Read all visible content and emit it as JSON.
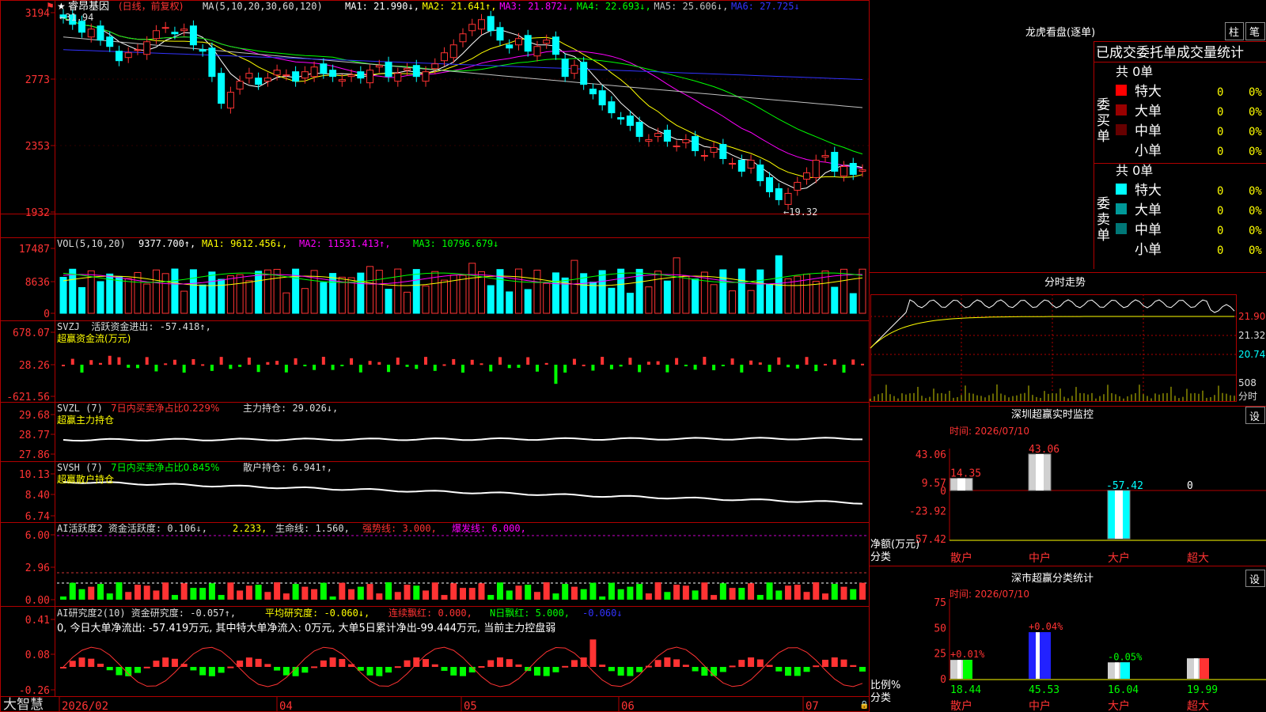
{
  "stock": {
    "marker": "★",
    "name": "睿昂基因",
    "period": "(日线，前复权)"
  },
  "price_panel": {
    "ma_title": "MA(5,10,20,30,60,120)",
    "ma_values": [
      {
        "label": "MA1:",
        "value": "21.990↓,",
        "color": "#ffffff"
      },
      {
        "label": "MA2:",
        "value": "21.641↑,",
        "color": "#ffff00"
      },
      {
        "label": "MA3:",
        "value": "21.872↓,",
        "color": "#ff00ff"
      },
      {
        "label": "MA4:",
        "value": "22.693↓,",
        "color": "#00ff00"
      },
      {
        "label": "MA5:",
        "value": "25.606↓,",
        "color": "#c0c0c0"
      },
      {
        "label": "MA6:",
        "value": "27.725↓",
        "color": "#3333ff"
      }
    ],
    "y_ticks": [
      "3194",
      "2773",
      "2353",
      "1932"
    ],
    "high_label": "←31.94",
    "low_label": "←19.32"
  },
  "vol_panel": {
    "title": "VOL(5,10,20)",
    "value": "9377.700↑,",
    "ma1": "MA1: 9612.456↓,",
    "ma2": "MA2: 11531.413↑,",
    "ma3": "MA3: 10796.679↓",
    "y_ticks": [
      "17487",
      "8636",
      "0"
    ]
  },
  "svzj_panel": {
    "title": "SVZJ  活跃资金进出: -57.418↑,",
    "subtitle": "超赢资金流(万元)",
    "y_ticks": [
      "678.07",
      "28.26",
      "-621.56"
    ]
  },
  "svzl_panel": {
    "title": "SVZL (7)",
    "t2": "7日内买卖净占比0.229%",
    "t3": "主力持仓: 29.026↓,",
    "subtitle": "超赢主力持仓",
    "y_ticks": [
      "29.68",
      "28.77",
      "27.86"
    ]
  },
  "svsh_panel": {
    "title": "SVSH (7)",
    "t2": "7日内买卖净占比0.845%",
    "t3": "散户持仓: 6.941↑,",
    "subtitle": "超赢散户持仓",
    "y_ticks": [
      "10.13",
      "8.40",
      "6.74"
    ]
  },
  "ai_act_panel": {
    "t1": "AI活跃度2 资金活跃度: 0.106↓,",
    "t2": "2.233,",
    "t3": "生命线: 1.560,",
    "t4": "强势线: 3.000,",
    "t5": "爆发线: 6.000,",
    "y_ticks": [
      "6.00",
      "2.96",
      "0.00"
    ]
  },
  "ai_res_panel": {
    "t1": "AI研究度2(10) 资金研究度: -0.057↑,",
    "t2": "平均研究度: -0.060↓,",
    "t3": "连续飘红: 0.000,",
    "t4": "N日飘红: 5.000,",
    "t5": "-0.060↓",
    "line2": "0, 今日大单净流出: -57.419万元, 其中特大单净流入: 0万元, 大单5日累计净出-99.444万元, 当前主力控盘弱",
    "y_ticks": [
      "0.41",
      "0.08",
      "-0.26"
    ]
  },
  "x_axis": {
    "brand": "大智慧",
    "labels": [
      "2026/02",
      "04",
      "05",
      "06",
      "07"
    ]
  },
  "dragon_tiger": {
    "title": "龙虎看盘(逐单)",
    "btn_zhu": "柱",
    "btn_bi": "笔",
    "tabs": [
      "已成交",
      "委托单",
      "成交量统计"
    ],
    "buy": {
      "side": "委买单",
      "total": "共 0单",
      "rows": [
        {
          "label": "特大",
          "count": "0",
          "pct": "0%",
          "color": "#ff0000"
        },
        {
          "label": "大单",
          "count": "0",
          "pct": "0%",
          "color": "#990000"
        },
        {
          "label": "中单",
          "count": "0",
          "pct": "0%",
          "color": "#660000"
        },
        {
          "label": "小单",
          "count": "0",
          "pct": "0%",
          "color": ""
        }
      ]
    },
    "sell": {
      "side": "委卖单",
      "total": "共 0单",
      "rows": [
        {
          "label": "特大",
          "count": "0",
          "pct": "0%",
          "color": "#00ffff"
        },
        {
          "label": "大单",
          "count": "0",
          "pct": "0%",
          "color": "#009999"
        },
        {
          "label": "中单",
          "count": "0",
          "pct": "0%",
          "color": "#007777"
        },
        {
          "label": "小单",
          "count": "0",
          "pct": "0%",
          "color": ""
        }
      ]
    }
  },
  "intraday": {
    "title": "分时走势",
    "price_ticks": [
      "21.90",
      "21.32",
      "20.74"
    ],
    "vol_ticks": [
      "508",
      "分时"
    ]
  },
  "monitor": {
    "title": "深圳超赢实时监控",
    "btn": "设",
    "time": "时间: 2026/07/10",
    "y_ticks": [
      "43.06",
      "9.57",
      "0",
      "-23.92",
      "-57.42"
    ],
    "ylabel": "净额(万元)",
    "xlabel": "分类",
    "categories": [
      "散户",
      "中户",
      "大户",
      "超大"
    ],
    "values": [
      14.35,
      43.06,
      -57.42,
      0
    ],
    "value_labels": [
      "14.35",
      "43.06",
      "-57.42",
      "0"
    ]
  },
  "classify": {
    "title": "深市超赢分类统计",
    "btn": "设",
    "time": "时间: 2026/07/10",
    "y_ticks": [
      "75",
      "50",
      "25",
      "0"
    ],
    "ylabel": "比例%",
    "xlabel": "分类",
    "categories": [
      "散户",
      "中户",
      "大户",
      "超大"
    ],
    "values": [
      18.44,
      45.53,
      16.04,
      19.99
    ],
    "value_labels": [
      "18.44",
      "45.53",
      "16.04",
      "19.99"
    ],
    "change_labels": [
      "+0.01%",
      "+0.04%",
      "-0.05%",
      ""
    ]
  },
  "chart_data": {
    "type": "candlestick",
    "title": "睿昂基因 (日线，前复权)",
    "x_labels": [
      "2026/02",
      "04",
      "05",
      "06",
      "07"
    ],
    "y_range": [
      19.32,
      31.94
    ],
    "close": [
      31.6,
      31.2,
      30.7,
      30.9,
      30.2,
      29.8,
      28.9,
      29.4,
      29.6,
      30.1,
      30.8,
      31.0,
      30.6,
      30.9,
      29.9,
      29.5,
      27.9,
      26.2,
      26.9,
      27.6,
      28.1,
      27.4,
      27.8,
      28.3,
      28.0,
      27.6,
      28.2,
      28.5,
      28.1,
      27.9,
      27.7,
      28.0,
      27.8,
      28.3,
      28.6,
      27.9,
      28.1,
      28.4,
      27.9,
      28.2,
      28.7,
      29.4,
      29.9,
      30.6,
      31.2,
      31.5,
      30.8,
      30.2,
      29.7,
      30.3,
      29.5,
      29.8,
      30.2,
      29.3,
      27.9,
      28.6,
      27.4,
      26.8,
      26.1,
      25.6,
      25.2,
      24.8,
      24.1,
      23.9,
      24.3,
      23.8,
      23.5,
      23.9,
      23.2,
      22.9,
      23.4,
      22.7,
      22.4,
      21.9,
      22.6,
      21.3,
      20.6,
      20.1,
      20.5,
      21.2,
      21.8,
      22.6,
      22.9,
      21.9,
      22.2,
      21.7,
      21.99
    ]
  }
}
